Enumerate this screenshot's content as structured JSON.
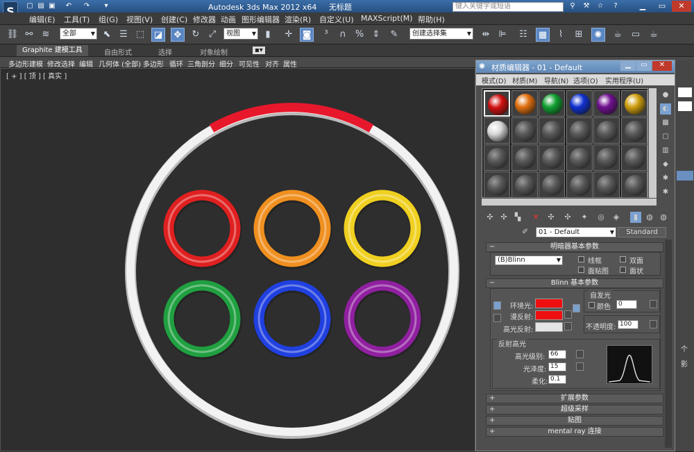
{
  "title": {
    "app": "Autodesk 3ds Max  2012 x64",
    "file": "无标题",
    "search_placeholder": "键入关键字或短语"
  },
  "menu": [
    "编辑(E)",
    "工具(T)",
    "组(G)",
    "视图(V)",
    "创建(C)",
    "修改器",
    "动画",
    "图形编辑器",
    "渲染(R)",
    "自定义(U)",
    "MAXScript(M)",
    "帮助(H)"
  ],
  "toolbar": {
    "selection_filter": "全部",
    "ref_coord": "视图",
    "named_selection": "创建选择集"
  },
  "ribbon": {
    "tabs": [
      "Graphite 建模工具",
      "自由形式",
      "选择",
      "对象绘制"
    ],
    "sub": [
      "多边形建模",
      "修改选择",
      "编辑",
      "几何体 (全部)",
      "多边形",
      "循环",
      "三角剖分",
      "细分",
      "可见性",
      "对齐",
      "属性"
    ]
  },
  "viewport": {
    "label": "[ + ] [ 顶 ] [ 真实 ]"
  },
  "material_editor": {
    "title": "材质编辑器 - 01 - Default",
    "menu": [
      "模式(D)",
      "材质(M)",
      "导航(N)",
      "选项(O)",
      "实用程序(U)"
    ],
    "material_name": "01 - Default",
    "material_type": "Standard",
    "shader_rollout": "明暗器基本参数",
    "shader": "(B)Blinn",
    "shader_options": [
      "线框",
      "双面",
      "面贴图",
      "面状"
    ],
    "blinn_rollout": "Blinn 基本参数",
    "self_illum_group": "自发光",
    "self_illum_color_label": "颜色",
    "self_illum_value": "0",
    "ambient_label": "环境光:",
    "diffuse_label": "漫反射:",
    "specular_label": "高光反射:",
    "opacity_label": "不透明度:",
    "opacity_value": "100",
    "specular_group": "反射高光",
    "spec_level_label": "高光级别:",
    "spec_level": "66",
    "glossiness_label": "光泽度:",
    "glossiness": "15",
    "soften_label": "柔化:",
    "soften": "0.1",
    "rollouts": [
      "扩展参数",
      "超级采样",
      "贴图",
      "mental ray 连接"
    ],
    "colors": {
      "ambient": "#ee1010",
      "diffuse": "#ee1010",
      "specular": "#e5e5e5"
    }
  },
  "scene_colors": [
    "#e02020",
    "#f09020",
    "#f0d020",
    "#20a040",
    "#2040e0",
    "#9020a0"
  ],
  "slot_colors": [
    "#d01010",
    "#e07010",
    "#10a030",
    "#1030d0",
    "#701090",
    "#d0a010",
    "#d8d8d8"
  ],
  "right_panel": [
    "个",
    "影"
  ]
}
